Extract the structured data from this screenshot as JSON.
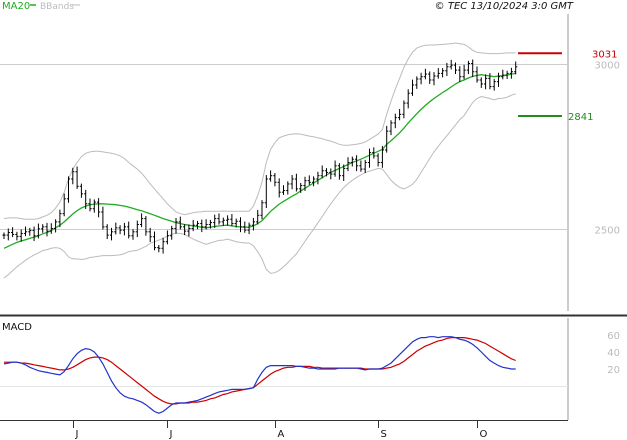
{
  "header": {
    "ma_label": "MA20",
    "bb_label": "BBands",
    "copyright": "© TEC 13/10/2024 3:0 GMT"
  },
  "colors": {
    "price": "#000000",
    "ma": "#22aa22",
    "bands": "#bbbbbb",
    "resistance": "#cc0000",
    "support": "#228b22",
    "macd": "#2233cc",
    "signal": "#cc0000",
    "grid": "#cccccc",
    "border": "#333333"
  },
  "chart_data": [
    {
      "type": "ohlc",
      "name": "price",
      "ma_label": "MA20",
      "bands_label": "BBands",
      "x_labels": [
        "J",
        "J",
        "A",
        "S",
        "O"
      ],
      "y_ticks": [
        2500,
        3000
      ],
      "ylim": [
        2250,
        3150
      ],
      "levels": [
        {
          "value": 3031,
          "label": "3031",
          "role": "resistance"
        },
        {
          "value": 2841,
          "label": "2841",
          "role": "support"
        }
      ],
      "close": [
        2480,
        2488,
        2482,
        2476,
        2485,
        2490,
        2494,
        2478,
        2499,
        2505,
        2492,
        2500,
        2520,
        2545,
        2590,
        2650,
        2672,
        2628,
        2605,
        2575,
        2560,
        2580,
        2550,
        2505,
        2480,
        2490,
        2502,
        2495,
        2505,
        2478,
        2490,
        2512,
        2530,
        2490,
        2475,
        2442,
        2440,
        2460,
        2478,
        2500,
        2520,
        2505,
        2492,
        2500,
        2510,
        2515,
        2505,
        2512,
        2518,
        2530,
        2520,
        2525,
        2528,
        2515,
        2522,
        2505,
        2495,
        2510,
        2520,
        2540,
        2578,
        2650,
        2660,
        2640,
        2610,
        2615,
        2635,
        2650,
        2620,
        2630,
        2645,
        2640,
        2650,
        2660,
        2675,
        2670,
        2665,
        2690,
        2660,
        2682,
        2700,
        2710,
        2690,
        2680,
        2700,
        2730,
        2720,
        2700,
        2738,
        2795,
        2820,
        2836,
        2846,
        2880,
        2910,
        2935,
        2953,
        2960,
        2968,
        2950,
        2962,
        2970,
        2978,
        2990,
        2995,
        2980,
        2960,
        2980,
        3000,
        2975,
        2950,
        2938,
        2955,
        2930,
        2945,
        2960,
        2965,
        2970,
        2975,
        2990
      ],
      "ma20": [
        2440,
        2446,
        2452,
        2458,
        2462,
        2466,
        2470,
        2474,
        2478,
        2484,
        2488,
        2494,
        2502,
        2510,
        2520,
        2532,
        2544,
        2554,
        2562,
        2568,
        2572,
        2574,
        2575,
        2575,
        2574,
        2573,
        2572,
        2570,
        2568,
        2565,
        2561,
        2557,
        2554,
        2549,
        2545,
        2540,
        2535,
        2530,
        2526,
        2522,
        2518,
        2515,
        2512,
        2510,
        2508,
        2506,
        2504,
        2502,
        2504,
        2506,
        2508,
        2509,
        2510,
        2508,
        2506,
        2505,
        2504,
        2504,
        2508,
        2515,
        2524,
        2538,
        2552,
        2563,
        2574,
        2582,
        2590,
        2598,
        2605,
        2614,
        2622,
        2630,
        2638,
        2646,
        2654,
        2662,
        2670,
        2676,
        2682,
        2688,
        2694,
        2700,
        2705,
        2710,
        2716,
        2722,
        2728,
        2734,
        2740,
        2755,
        2766,
        2778,
        2790,
        2804,
        2820,
        2834,
        2848,
        2861,
        2873,
        2884,
        2894,
        2903,
        2912,
        2920,
        2929,
        2938,
        2945,
        2950,
        2956,
        2961,
        2964,
        2966,
        2964,
        2962,
        2960,
        2962,
        2963,
        2965,
        2968,
        2970
      ],
      "upper_band": [
        2530,
        2532,
        2532,
        2532,
        2530,
        2528,
        2528,
        2528,
        2530,
        2535,
        2540,
        2548,
        2562,
        2580,
        2610,
        2650,
        2680,
        2700,
        2718,
        2728,
        2732,
        2734,
        2734,
        2732,
        2730,
        2728,
        2725,
        2720,
        2712,
        2700,
        2690,
        2680,
        2668,
        2652,
        2635,
        2620,
        2605,
        2590,
        2575,
        2562,
        2550,
        2545,
        2542,
        2545,
        2548,
        2550,
        2551,
        2552,
        2552,
        2552,
        2552,
        2553,
        2552,
        2552,
        2552,
        2552,
        2552,
        2552,
        2568,
        2600,
        2640,
        2700,
        2740,
        2760,
        2775,
        2780,
        2784,
        2786,
        2787,
        2786,
        2783,
        2780,
        2778,
        2775,
        2772,
        2768,
        2765,
        2760,
        2755,
        2752,
        2752,
        2754,
        2755,
        2758,
        2762,
        2770,
        2778,
        2786,
        2800,
        2846,
        2886,
        2922,
        2955,
        2988,
        3014,
        3034,
        3047,
        3052,
        3055,
        3056,
        3056,
        3057,
        3058,
        3059,
        3060,
        3062,
        3060,
        3058,
        3050,
        3040,
        3034,
        3032,
        3031,
        3030,
        3030,
        3030,
        3031,
        3032,
        3032,
        3032
      ],
      "lower_band": [
        2350,
        2360,
        2372,
        2384,
        2394,
        2404,
        2412,
        2420,
        2426,
        2433,
        2436,
        2440,
        2442,
        2440,
        2430,
        2414,
        2408,
        2408,
        2406,
        2408,
        2412,
        2414,
        2416,
        2418,
        2418,
        2418,
        2419,
        2420,
        2424,
        2430,
        2432,
        2434,
        2440,
        2446,
        2455,
        2460,
        2465,
        2470,
        2477,
        2482,
        2486,
        2485,
        2482,
        2475,
        2468,
        2462,
        2457,
        2452,
        2456,
        2460,
        2464,
        2465,
        2468,
        2464,
        2460,
        2458,
        2456,
        2456,
        2448,
        2430,
        2408,
        2376,
        2364,
        2366,
        2373,
        2384,
        2396,
        2410,
        2423,
        2442,
        2461,
        2480,
        2498,
        2517,
        2536,
        2556,
        2575,
        2592,
        2609,
        2624,
        2636,
        2646,
        2655,
        2662,
        2670,
        2674,
        2678,
        2682,
        2680,
        2664,
        2646,
        2634,
        2625,
        2620,
        2626,
        2634,
        2649,
        2670,
        2691,
        2712,
        2732,
        2749,
        2766,
        2781,
        2798,
        2814,
        2830,
        2842,
        2862,
        2882,
        2894,
        2900,
        2897,
        2894,
        2890,
        2894,
        2895,
        2898,
        2904,
        2908
      ]
    },
    {
      "type": "line",
      "name": "macd",
      "title": "MACD",
      "y_ticks": [
        60,
        40,
        20
      ],
      "ylim": [
        -40,
        80
      ],
      "macd": [
        26,
        27,
        28,
        28,
        27,
        25,
        22,
        20,
        18,
        17,
        16,
        15,
        14,
        13,
        17,
        24,
        32,
        38,
        42,
        44,
        43,
        40,
        34,
        26,
        16,
        6,
        -2,
        -8,
        -12,
        -14,
        -15,
        -17,
        -19,
        -22,
        -26,
        -30,
        -32,
        -30,
        -26,
        -22,
        -20,
        -20,
        -20,
        -19,
        -18,
        -17,
        -15,
        -13,
        -11,
        -9,
        -7,
        -6,
        -5,
        -4,
        -4,
        -4,
        -4,
        -3,
        -2,
        8,
        16,
        22,
        24,
        24,
        24,
        24,
        24,
        24,
        23,
        23,
        22,
        21,
        21,
        20,
        20,
        20,
        20,
        20,
        21,
        21,
        21,
        21,
        21,
        20,
        19,
        20,
        20,
        20,
        21,
        24,
        27,
        32,
        37,
        42,
        47,
        52,
        55,
        57,
        57,
        58,
        58,
        57,
        58,
        58,
        58,
        57,
        55,
        54,
        52,
        49,
        45,
        40,
        35,
        30,
        27,
        24,
        22,
        21,
        20,
        20
      ],
      "signal": [
        28,
        28,
        28,
        28,
        27,
        27,
        26,
        25,
        24,
        23,
        22,
        21,
        20,
        19,
        19,
        20,
        22,
        25,
        28,
        31,
        33,
        34,
        34,
        33,
        31,
        28,
        24,
        20,
        16,
        12,
        8,
        4,
        0,
        -4,
        -8,
        -12,
        -15,
        -18,
        -20,
        -21,
        -21,
        -20,
        -20,
        -20,
        -19,
        -19,
        -18,
        -17,
        -15,
        -14,
        -12,
        -10,
        -9,
        -7,
        -6,
        -5,
        -4,
        -3,
        -2,
        2,
        6,
        10,
        14,
        17,
        19,
        21,
        22,
        22,
        23,
        23,
        23,
        23,
        22,
        22,
        21,
        21,
        21,
        21,
        21,
        21,
        21,
        21,
        21,
        21,
        20,
        20,
        20,
        20,
        20,
        21,
        22,
        24,
        26,
        29,
        33,
        37,
        41,
        44,
        47,
        49,
        51,
        53,
        54,
        56,
        57,
        57,
        57,
        57,
        56,
        55,
        54,
        52,
        50,
        47,
        44,
        41,
        38,
        35,
        32,
        30
      ]
    }
  ]
}
